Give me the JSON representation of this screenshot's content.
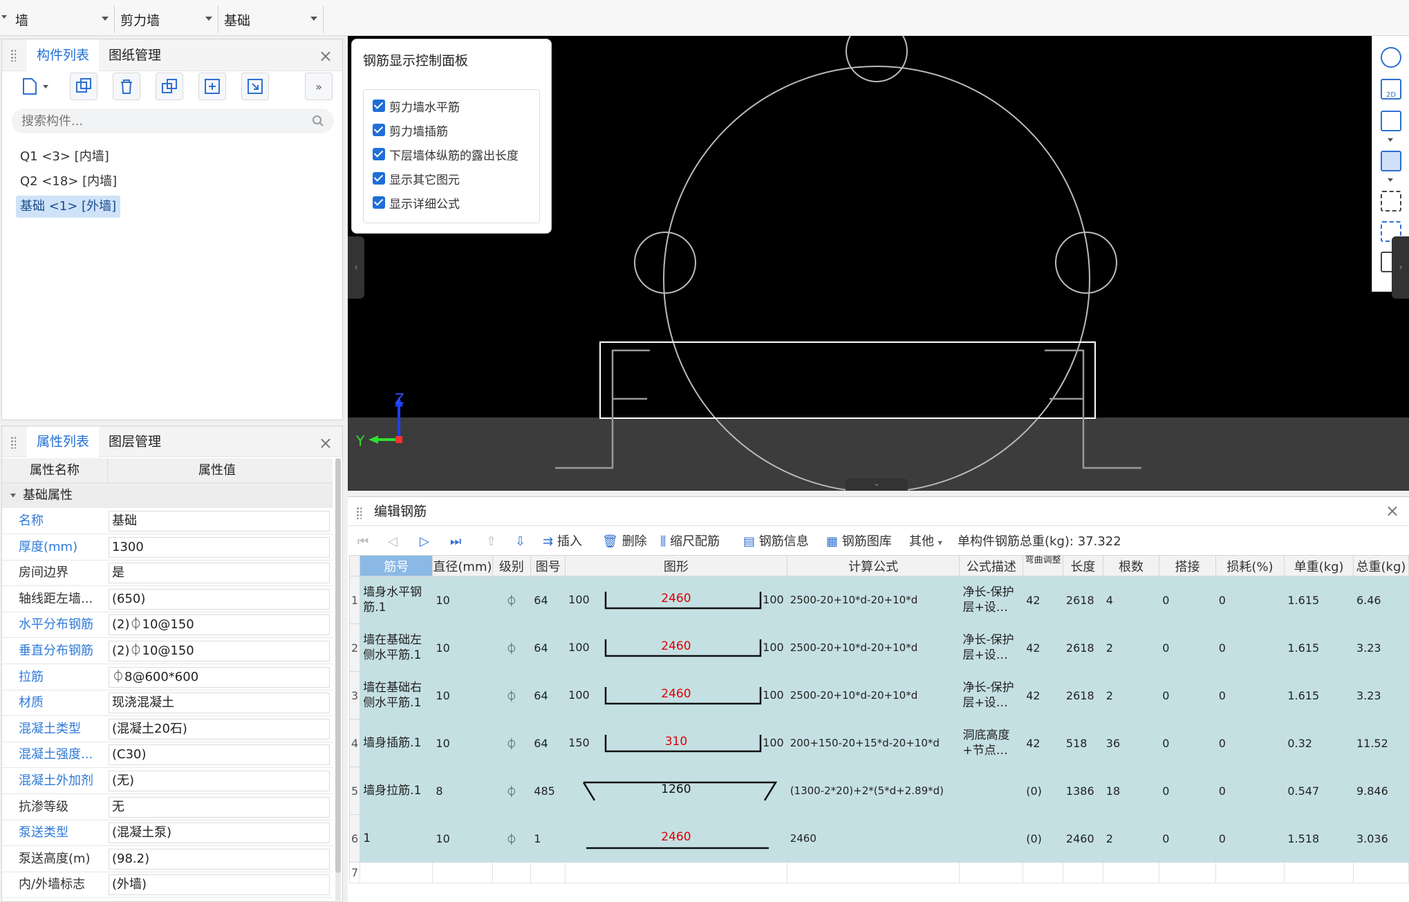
{
  "topbar": {
    "dropdowns": [
      "墙",
      "剪力墙",
      "基础"
    ]
  },
  "component_panel": {
    "tabs": [
      "构件列表",
      "图纸管理"
    ],
    "search_placeholder": "搜索构件...",
    "items": [
      "Q1 <3> [内墙]",
      "Q2 <18> [内墙]",
      "基础 <1> [外墙]"
    ],
    "selected_index": 2
  },
  "property_panel": {
    "tabs": [
      "属性列表",
      "图层管理"
    ],
    "col_name": "属性名称",
    "col_value": "属性值",
    "group": "基础属性",
    "rows": [
      {
        "name": "名称",
        "value": "基础",
        "blue": true
      },
      {
        "name": "厚度(mm)",
        "value": "1300",
        "blue": true
      },
      {
        "name": "房间边界",
        "value": "是",
        "blue": false
      },
      {
        "name": "轴线距左墙...",
        "value": "(650)",
        "blue": false
      },
      {
        "name": "水平分布钢筋",
        "value": "(2)⏀10@150",
        "blue": true
      },
      {
        "name": "垂直分布钢筋",
        "value": "(2)⏀10@150",
        "blue": true
      },
      {
        "name": "拉筋",
        "value": "⏀8@600*600",
        "blue": true
      },
      {
        "name": "材质",
        "value": "现浇混凝土",
        "blue": true
      },
      {
        "name": "混凝土类型",
        "value": "(混凝土20石)",
        "blue": true
      },
      {
        "name": "混凝土强度...",
        "value": "(C30)",
        "blue": true
      },
      {
        "name": "混凝土外加剂",
        "value": "(无)",
        "blue": true
      },
      {
        "name": "抗渗等级",
        "value": "无",
        "blue": false
      },
      {
        "name": "泵送类型",
        "value": "(混凝土泵)",
        "blue": true
      },
      {
        "name": "泵送高度(m)",
        "value": "(98.2)",
        "blue": false
      },
      {
        "name": "内/外墙标志",
        "value": "(外墙)",
        "blue": false
      }
    ]
  },
  "control_panel": {
    "title": "钢筋显示控制面板",
    "options": [
      "剪力墙水平筋",
      "剪力墙插筋",
      "下层墙体纵筋的露出长度",
      "显示其它图元",
      "显示详细公式"
    ]
  },
  "viewport": {
    "axis_z": "Z",
    "axis_y": "Y",
    "tool_2d": "2D"
  },
  "editor": {
    "title": "编辑钢筋",
    "tools": {
      "insert": "插入",
      "delete": "删除",
      "scale": "缩尺配筋",
      "info": "钢筋信息",
      "library": "钢筋图库",
      "other": "其他",
      "total_label": "单构件钢筋总重(kg):",
      "total_value": "37.322"
    },
    "columns": [
      "筋号",
      "直径(mm)",
      "级别",
      "图号",
      "图形",
      "计算公式",
      "公式描述",
      "弯曲调整",
      "长度",
      "根数",
      "搭接",
      "损耗(%)",
      "单重(kg)",
      "总重(kg)"
    ],
    "rows": [
      {
        "idx": "1",
        "name": "墙身水平钢筋.1",
        "dia": "10",
        "grade": "⏀",
        "fig": "64",
        "s_left": "100",
        "s_mid": "2460",
        "s_right": "100",
        "formula": "2500-20+10*d-20+10*d",
        "desc": "净长-保护层+设…",
        "bend": "42",
        "len": "2618",
        "count": "4",
        "lap": "0",
        "loss": "0",
        "unit": "1.615",
        "total": "6.46"
      },
      {
        "idx": "2",
        "name": "墙在基础左侧水平筋.1",
        "dia": "10",
        "grade": "⏀",
        "fig": "64",
        "s_left": "100",
        "s_mid": "2460",
        "s_right": "100",
        "formula": "2500-20+10*d-20+10*d",
        "desc": "净长-保护层+设…",
        "bend": "42",
        "len": "2618",
        "count": "2",
        "lap": "0",
        "loss": "0",
        "unit": "1.615",
        "total": "3.23"
      },
      {
        "idx": "3",
        "name": "墙在基础右侧水平筋.1",
        "dia": "10",
        "grade": "⏀",
        "fig": "64",
        "s_left": "100",
        "s_mid": "2460",
        "s_right": "100",
        "formula": "2500-20+10*d-20+10*d",
        "desc": "净长-保护层+设…",
        "bend": "42",
        "len": "2618",
        "count": "2",
        "lap": "0",
        "loss": "0",
        "unit": "1.615",
        "total": "3.23"
      },
      {
        "idx": "4",
        "name": "墙身插筋.1",
        "dia": "10",
        "grade": "⏀",
        "fig": "64",
        "s_left": "150",
        "s_mid": "310",
        "s_right": "100",
        "formula": "200+150-20+15*d-20+10*d",
        "desc": "洞底高度+节点…",
        "bend": "42",
        "len": "518",
        "count": "36",
        "lap": "0",
        "loss": "0",
        "unit": "0.32",
        "total": "11.52"
      },
      {
        "idx": "5",
        "name": "墙身拉筋.1",
        "dia": "8",
        "grade": "⏀",
        "fig": "485",
        "s_left": "",
        "s_mid": "1260",
        "s_right": "",
        "formula": "(1300-2*20)+2*(5*d+2.89*d)",
        "desc": "",
        "bend": "(0)",
        "len": "1386",
        "count": "18",
        "lap": "0",
        "loss": "0",
        "unit": "0.547",
        "total": "9.846"
      },
      {
        "idx": "6",
        "name": "1",
        "dia": "10",
        "grade": "⏀",
        "fig": "1",
        "s_left": "",
        "s_mid": "2460",
        "s_right": "",
        "formula": "2460",
        "desc": "",
        "bend": "(0)",
        "len": "2460",
        "count": "2",
        "lap": "0",
        "loss": "0",
        "unit": "1.518",
        "total": "3.036"
      }
    ],
    "empty_row_idx": "7"
  }
}
